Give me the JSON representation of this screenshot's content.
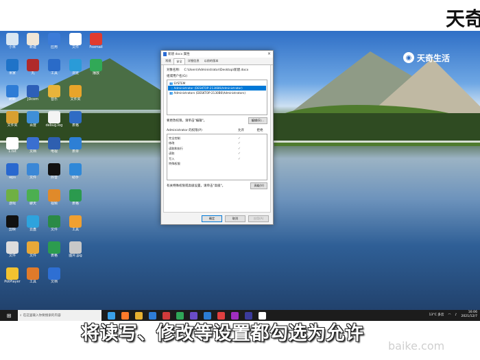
{
  "brand_corner": "天奇",
  "logo": {
    "text": "天奇生活"
  },
  "subtitle": "将读写、修改等设置都勾选为允许",
  "watermark": "baike.com",
  "desktop_icons": [
    {
      "label": "小米",
      "color": "#d9e6f2"
    },
    {
      "label": "新建",
      "color": "#f0e6d6"
    },
    {
      "label": "应用",
      "color": "#3b7bd8"
    },
    {
      "label": "文件",
      "color": "#ffffff"
    },
    {
      "label": "Foxmail",
      "color": "#e03b2f"
    },
    {
      "label": "米家",
      "color": "#1f73c8"
    },
    {
      "label": "丸",
      "color": "#b02a2a"
    },
    {
      "label": "工具",
      "color": "#2a6bc8"
    },
    {
      "label": "浏览",
      "color": "#2a9bd8"
    },
    {
      "label": "播放",
      "color": "#31a957"
    },
    {
      "label": "刷新",
      "color": "#2e7cd6"
    },
    {
      "label": "文件夹",
      "color": "#e8a42a"
    },
    {
      "label": "JDcom",
      "color": "#2d5fb8"
    },
    {
      "label": "音乐",
      "color": "#e8b43a"
    },
    {
      "label": "文件夹",
      "color": "#d9a030"
    },
    {
      "label": "百度",
      "color": "#3f8fd8"
    },
    {
      "label": "debug.log",
      "color": "#f4f4f4"
    },
    {
      "label": "表格",
      "color": "#2f6cc4"
    },
    {
      "label": "1.txt",
      "color": "#ffffff"
    },
    {
      "label": "文档",
      "color": "#3a6fd0"
    },
    {
      "label": "电视",
      "color": "#2e5fb0"
    },
    {
      "label": "表单",
      "color": "#2d7fd5"
    },
    {
      "label": "wps",
      "color": "#2968cf"
    },
    {
      "label": "文件",
      "color": "#3b87d6"
    },
    {
      "label": "抖音",
      "color": "#111111"
    },
    {
      "label": "助手",
      "color": "#2f88d8"
    },
    {
      "label": "游戏",
      "color": "#6fb043"
    },
    {
      "label": "聊天",
      "color": "#4caf50"
    },
    {
      "label": "视频",
      "color": "#e08a2a"
    },
    {
      "label": "表格",
      "color": "#2b9a4e"
    },
    {
      "label": "剪映",
      "color": "#111111"
    },
    {
      "label": "云盘",
      "color": "#2ea3dd"
    },
    {
      "label": "文件",
      "color": "#2b8a46"
    },
    {
      "label": "工具",
      "color": "#f0a030"
    },
    {
      "label": "文件",
      "color": "#dddddd"
    },
    {
      "label": "文件",
      "color": "#e8a838"
    },
    {
      "label": "表格",
      "color": "#2c9c4f"
    },
    {
      "label": "图片.jpg",
      "color": "#c8c8c8"
    },
    {
      "label": "PotPlayer",
      "color": "#f2c230"
    },
    {
      "label": "工具",
      "color": "#e07a2a"
    },
    {
      "label": "文档",
      "color": "#2e6fd3"
    }
  ],
  "dialog": {
    "title": "新建 docx 属性",
    "close": "×",
    "tabs": [
      "常规",
      "安全",
      "详细信息",
      "以前的版本"
    ],
    "active_tab": 1,
    "object_label": "对象名称:",
    "object_value": "C:\\Users\\Administrator\\Desktop\\新建.docx",
    "groups_label": "组或用户名(G):",
    "groups": [
      {
        "name": "SYSTEM",
        "selected": false
      },
      {
        "name": "Administrator (DESKTOP-2130B6\\Administrator)",
        "selected": true
      },
      {
        "name": "Administrators (DESKTOP-2130B6\\Administrators)",
        "selected": false
      }
    ],
    "change_hint": "要更改权限，请单击\"编辑\"。",
    "edit_button": "编辑(E)...",
    "perm_label": "Administrator 的权限(P)",
    "allow_label": "允许",
    "deny_label": "拒绝",
    "permissions": [
      {
        "name": "完全控制",
        "allow": "✓"
      },
      {
        "name": "修改",
        "allow": "✓"
      },
      {
        "name": "读取和执行",
        "allow": "✓"
      },
      {
        "name": "读取",
        "allow": "✓"
      },
      {
        "name": "写入",
        "allow": "✓"
      },
      {
        "name": "特殊权限",
        "allow": ""
      }
    ],
    "advanced_hint": "有关特殊权限或高级设置，请单击\"高级\"。",
    "advanced_button": "高级(V)",
    "ok_button": "确定",
    "cancel_button": "取消",
    "apply_button": "应用(A)"
  },
  "taskbar": {
    "search_placeholder": "在这里输入你要搜索的内容",
    "weather": "13°C 多云",
    "time": "16:06",
    "date": "2021/12/7",
    "app_colors": [
      "#3aa0e8",
      "#ff7a2a",
      "#e8b030",
      "#2e7cd6",
      "#d13b3b",
      "#2fa858",
      "#6a4cc8",
      "#2b7cd3",
      "#e04040",
      "#a02ec0",
      "#3b3b9b",
      "#ffffff"
    ]
  }
}
